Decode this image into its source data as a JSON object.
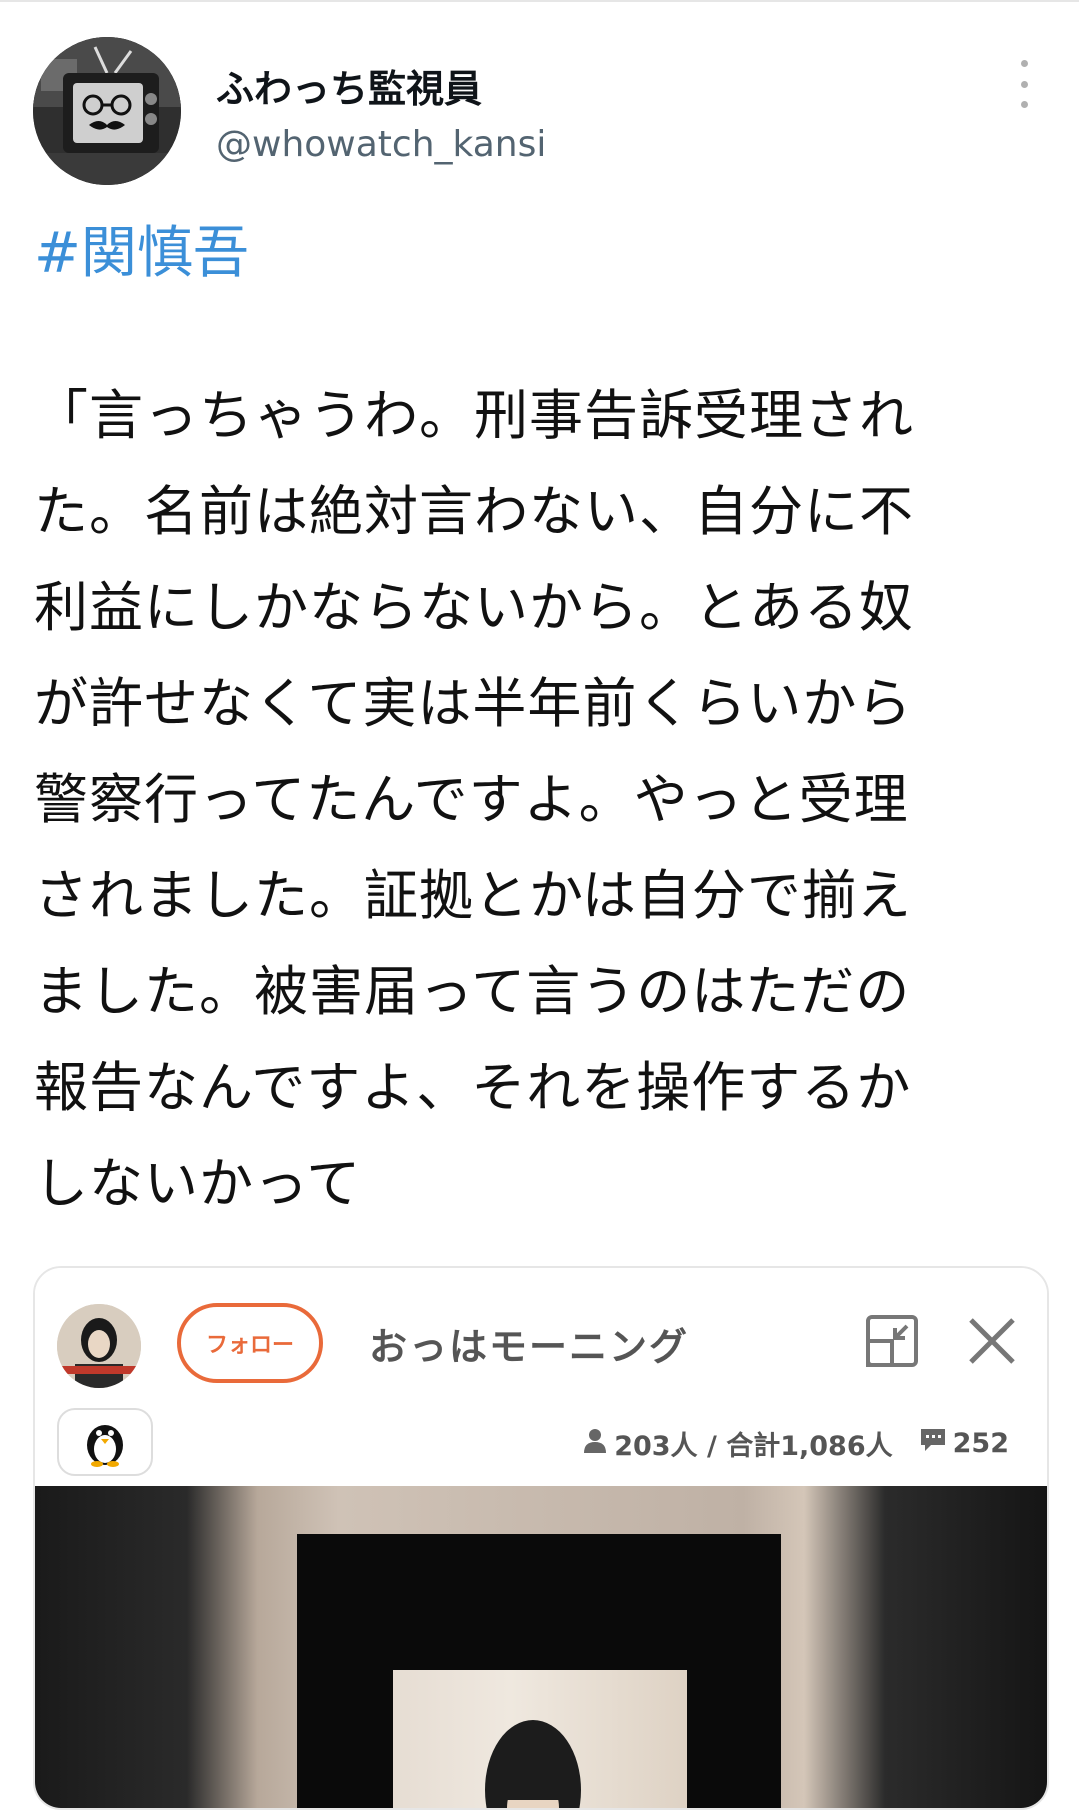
{
  "tweet": {
    "display_name": "ふわっち監視員",
    "handle": "@whowatch_kansi",
    "hashtag": "#関慎吾",
    "body_lines": [
      "「言っちゃうわ。刑事告訴受理され",
      "た。名前は絶対言わない、自分に不",
      "利益にしかならないから。とある奴",
      "が許せなくて実は半年前くらいから",
      "警察行ってたんですよ。やっと受理",
      "されました。証拠とかは自分で揃え",
      "ました。被害届って言うのはただの",
      "報告なんですよ、それを操作するか",
      "しないかって"
    ]
  },
  "card": {
    "follow_label": "フォロー",
    "live_title": "おっはモーニング",
    "viewers": "203人 / 合計1,086人",
    "comments": "252"
  },
  "colors": {
    "hashtag": "#3b8fd8",
    "follow": "#e96a3a"
  }
}
